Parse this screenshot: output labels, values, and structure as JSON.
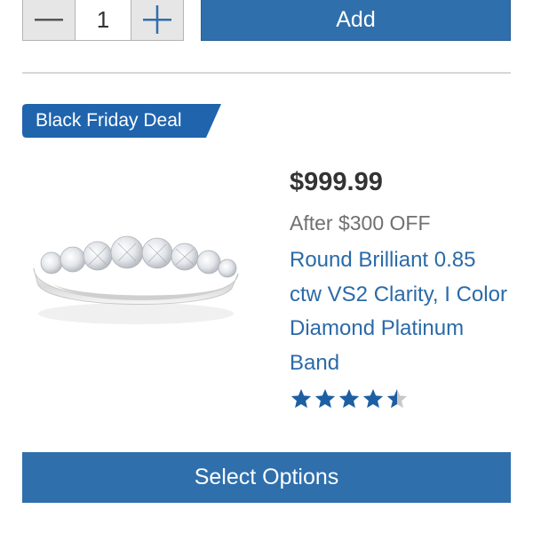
{
  "quantity": {
    "value": "1",
    "decrement_icon": "minus-icon",
    "increment_icon": "plus-icon"
  },
  "add_button": {
    "label": "Add"
  },
  "product": {
    "badge": "Black Friday Deal",
    "price": "$999.99",
    "discount": "After $300 OFF",
    "title": "Round Brilliant 0.85 ctw VS2 Clarity, I Color Diamond Platinum Band",
    "rating": 4.5,
    "rating_max": 5,
    "image_icon": "diamond-ring-image"
  },
  "select_button": {
    "label": "Select Options"
  },
  "colors": {
    "accent_blue": "#2f6fac",
    "badge_blue": "#1f64ad",
    "link_blue": "#2b6aa8",
    "star_blue": "#1d5fa3",
    "star_empty": "#c8c8c8"
  }
}
